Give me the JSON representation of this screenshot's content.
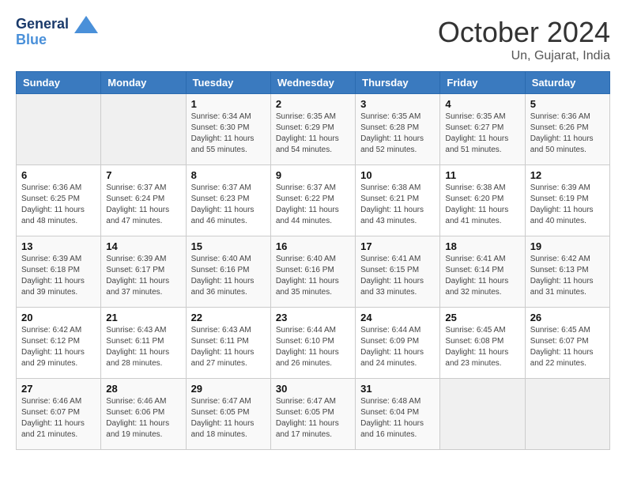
{
  "header": {
    "logo_line1": "General",
    "logo_line2": "Blue",
    "month": "October 2024",
    "location": "Un, Gujarat, India"
  },
  "weekdays": [
    "Sunday",
    "Monday",
    "Tuesday",
    "Wednesday",
    "Thursday",
    "Friday",
    "Saturday"
  ],
  "weeks": [
    [
      {
        "day": "",
        "sunrise": "",
        "sunset": "",
        "daylight": ""
      },
      {
        "day": "",
        "sunrise": "",
        "sunset": "",
        "daylight": ""
      },
      {
        "day": "1",
        "sunrise": "Sunrise: 6:34 AM",
        "sunset": "Sunset: 6:30 PM",
        "daylight": "Daylight: 11 hours and 55 minutes."
      },
      {
        "day": "2",
        "sunrise": "Sunrise: 6:35 AM",
        "sunset": "Sunset: 6:29 PM",
        "daylight": "Daylight: 11 hours and 54 minutes."
      },
      {
        "day": "3",
        "sunrise": "Sunrise: 6:35 AM",
        "sunset": "Sunset: 6:28 PM",
        "daylight": "Daylight: 11 hours and 52 minutes."
      },
      {
        "day": "4",
        "sunrise": "Sunrise: 6:35 AM",
        "sunset": "Sunset: 6:27 PM",
        "daylight": "Daylight: 11 hours and 51 minutes."
      },
      {
        "day": "5",
        "sunrise": "Sunrise: 6:36 AM",
        "sunset": "Sunset: 6:26 PM",
        "daylight": "Daylight: 11 hours and 50 minutes."
      }
    ],
    [
      {
        "day": "6",
        "sunrise": "Sunrise: 6:36 AM",
        "sunset": "Sunset: 6:25 PM",
        "daylight": "Daylight: 11 hours and 48 minutes."
      },
      {
        "day": "7",
        "sunrise": "Sunrise: 6:37 AM",
        "sunset": "Sunset: 6:24 PM",
        "daylight": "Daylight: 11 hours and 47 minutes."
      },
      {
        "day": "8",
        "sunrise": "Sunrise: 6:37 AM",
        "sunset": "Sunset: 6:23 PM",
        "daylight": "Daylight: 11 hours and 46 minutes."
      },
      {
        "day": "9",
        "sunrise": "Sunrise: 6:37 AM",
        "sunset": "Sunset: 6:22 PM",
        "daylight": "Daylight: 11 hours and 44 minutes."
      },
      {
        "day": "10",
        "sunrise": "Sunrise: 6:38 AM",
        "sunset": "Sunset: 6:21 PM",
        "daylight": "Daylight: 11 hours and 43 minutes."
      },
      {
        "day": "11",
        "sunrise": "Sunrise: 6:38 AM",
        "sunset": "Sunset: 6:20 PM",
        "daylight": "Daylight: 11 hours and 41 minutes."
      },
      {
        "day": "12",
        "sunrise": "Sunrise: 6:39 AM",
        "sunset": "Sunset: 6:19 PM",
        "daylight": "Daylight: 11 hours and 40 minutes."
      }
    ],
    [
      {
        "day": "13",
        "sunrise": "Sunrise: 6:39 AM",
        "sunset": "Sunset: 6:18 PM",
        "daylight": "Daylight: 11 hours and 39 minutes."
      },
      {
        "day": "14",
        "sunrise": "Sunrise: 6:39 AM",
        "sunset": "Sunset: 6:17 PM",
        "daylight": "Daylight: 11 hours and 37 minutes."
      },
      {
        "day": "15",
        "sunrise": "Sunrise: 6:40 AM",
        "sunset": "Sunset: 6:16 PM",
        "daylight": "Daylight: 11 hours and 36 minutes."
      },
      {
        "day": "16",
        "sunrise": "Sunrise: 6:40 AM",
        "sunset": "Sunset: 6:16 PM",
        "daylight": "Daylight: 11 hours and 35 minutes."
      },
      {
        "day": "17",
        "sunrise": "Sunrise: 6:41 AM",
        "sunset": "Sunset: 6:15 PM",
        "daylight": "Daylight: 11 hours and 33 minutes."
      },
      {
        "day": "18",
        "sunrise": "Sunrise: 6:41 AM",
        "sunset": "Sunset: 6:14 PM",
        "daylight": "Daylight: 11 hours and 32 minutes."
      },
      {
        "day": "19",
        "sunrise": "Sunrise: 6:42 AM",
        "sunset": "Sunset: 6:13 PM",
        "daylight": "Daylight: 11 hours and 31 minutes."
      }
    ],
    [
      {
        "day": "20",
        "sunrise": "Sunrise: 6:42 AM",
        "sunset": "Sunset: 6:12 PM",
        "daylight": "Daylight: 11 hours and 29 minutes."
      },
      {
        "day": "21",
        "sunrise": "Sunrise: 6:43 AM",
        "sunset": "Sunset: 6:11 PM",
        "daylight": "Daylight: 11 hours and 28 minutes."
      },
      {
        "day": "22",
        "sunrise": "Sunrise: 6:43 AM",
        "sunset": "Sunset: 6:11 PM",
        "daylight": "Daylight: 11 hours and 27 minutes."
      },
      {
        "day": "23",
        "sunrise": "Sunrise: 6:44 AM",
        "sunset": "Sunset: 6:10 PM",
        "daylight": "Daylight: 11 hours and 26 minutes."
      },
      {
        "day": "24",
        "sunrise": "Sunrise: 6:44 AM",
        "sunset": "Sunset: 6:09 PM",
        "daylight": "Daylight: 11 hours and 24 minutes."
      },
      {
        "day": "25",
        "sunrise": "Sunrise: 6:45 AM",
        "sunset": "Sunset: 6:08 PM",
        "daylight": "Daylight: 11 hours and 23 minutes."
      },
      {
        "day": "26",
        "sunrise": "Sunrise: 6:45 AM",
        "sunset": "Sunset: 6:07 PM",
        "daylight": "Daylight: 11 hours and 22 minutes."
      }
    ],
    [
      {
        "day": "27",
        "sunrise": "Sunrise: 6:46 AM",
        "sunset": "Sunset: 6:07 PM",
        "daylight": "Daylight: 11 hours and 21 minutes."
      },
      {
        "day": "28",
        "sunrise": "Sunrise: 6:46 AM",
        "sunset": "Sunset: 6:06 PM",
        "daylight": "Daylight: 11 hours and 19 minutes."
      },
      {
        "day": "29",
        "sunrise": "Sunrise: 6:47 AM",
        "sunset": "Sunset: 6:05 PM",
        "daylight": "Daylight: 11 hours and 18 minutes."
      },
      {
        "day": "30",
        "sunrise": "Sunrise: 6:47 AM",
        "sunset": "Sunset: 6:05 PM",
        "daylight": "Daylight: 11 hours and 17 minutes."
      },
      {
        "day": "31",
        "sunrise": "Sunrise: 6:48 AM",
        "sunset": "Sunset: 6:04 PM",
        "daylight": "Daylight: 11 hours and 16 minutes."
      },
      {
        "day": "",
        "sunrise": "",
        "sunset": "",
        "daylight": ""
      },
      {
        "day": "",
        "sunrise": "",
        "sunset": "",
        "daylight": ""
      }
    ]
  ]
}
